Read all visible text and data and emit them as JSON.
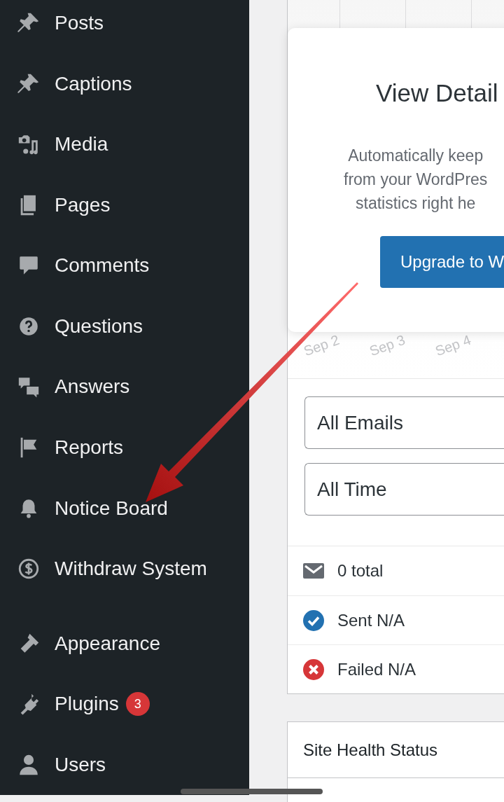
{
  "sidebar": {
    "groups": [
      [
        {
          "label": "Posts"
        },
        {
          "label": "Captions"
        },
        {
          "label": "Media"
        },
        {
          "label": "Pages"
        },
        {
          "label": "Comments"
        },
        {
          "label": "Questions"
        },
        {
          "label": "Answers"
        },
        {
          "label": "Reports"
        },
        {
          "label": "Notice Board"
        },
        {
          "label": "Withdraw System"
        }
      ],
      [
        {
          "label": "Appearance"
        },
        {
          "label": "Plugins",
          "badge": "3"
        },
        {
          "label": "Users"
        }
      ]
    ]
  },
  "email_card": {
    "chart_axis_labels": [
      "Sep 2",
      "Sep 3",
      "Sep 4"
    ],
    "overlay": {
      "title": "View Detail",
      "text_lines": [
        "Automatically keep",
        "from your WordPres",
        "statistics right he"
      ],
      "button": "Upgrade to W"
    },
    "filters": [
      {
        "value": "All Emails"
      },
      {
        "value": "All Time"
      }
    ],
    "stats": [
      {
        "kind": "total",
        "text": "0 total"
      },
      {
        "kind": "sent",
        "text": "Sent N/A"
      },
      {
        "kind": "failed",
        "text": "Failed N/A"
      }
    ]
  },
  "site_health": {
    "title": "Site Health Status"
  }
}
